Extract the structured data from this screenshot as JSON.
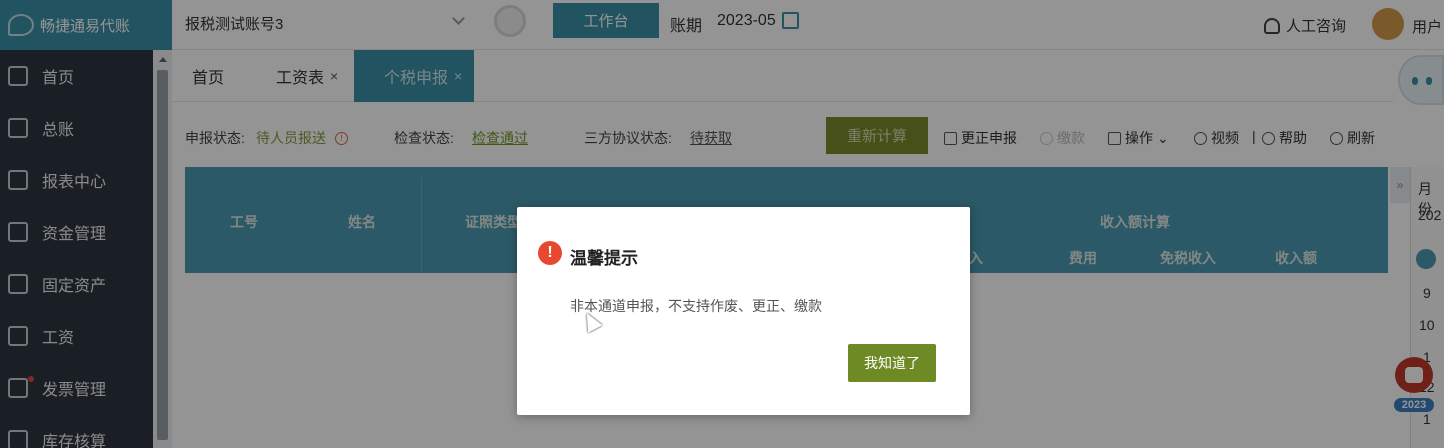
{
  "app": {
    "name": "畅捷通易代账"
  },
  "sidebar": {
    "items": [
      {
        "label": "首页",
        "icon": "home-icon"
      },
      {
        "label": "总账",
        "icon": "ledger-icon"
      },
      {
        "label": "报表中心",
        "icon": "chart-icon"
      },
      {
        "label": "资金管理",
        "icon": "money-bag-icon"
      },
      {
        "label": "固定资产",
        "icon": "building-icon"
      },
      {
        "label": "工资",
        "icon": "salary-icon"
      },
      {
        "label": "发票管理",
        "icon": "invoice-icon"
      },
      {
        "label": "库存核算",
        "icon": "inventory-icon"
      }
    ]
  },
  "topbar": {
    "account": "报税测试账号3",
    "workbench": "工作台",
    "period_label": "账期",
    "period_value": "2023-05",
    "support": "人工咨询",
    "user": "用户"
  },
  "tabs": [
    {
      "label": "首页"
    },
    {
      "label": "工资表",
      "close": "×"
    },
    {
      "label": "个税申报",
      "close": "×"
    }
  ],
  "status": {
    "declare_label": "申报状态:",
    "declare_value": "待人员报送",
    "check_label": "检查状态:",
    "check_value": "检查通过",
    "agreement_label": "三方协议状态:",
    "agreement_value": "待获取"
  },
  "toolbar": {
    "recalc": "重新计算",
    "correct": "更正申报",
    "pay": "缴款",
    "ops": "操作",
    "video": "视频",
    "help": "帮助",
    "refresh": "刷新"
  },
  "table": {
    "headers": {
      "id": "工号",
      "name": "姓名",
      "cert_type": "证照类型",
      "income_calc": "收入额计算",
      "income": "收入",
      "expense": "费用",
      "tax_free": "免税收入",
      "income_amount": "收入额"
    }
  },
  "right_panel": {
    "month_label": "月份",
    "year": "202",
    "days": [
      "9",
      "10",
      "1",
      "12",
      "1"
    ]
  },
  "badge": {
    "year": "2023"
  },
  "modal": {
    "title": "温馨提示",
    "message": "非本通道申报，不支持作废、更正、缴款",
    "ok": "我知道了"
  }
}
